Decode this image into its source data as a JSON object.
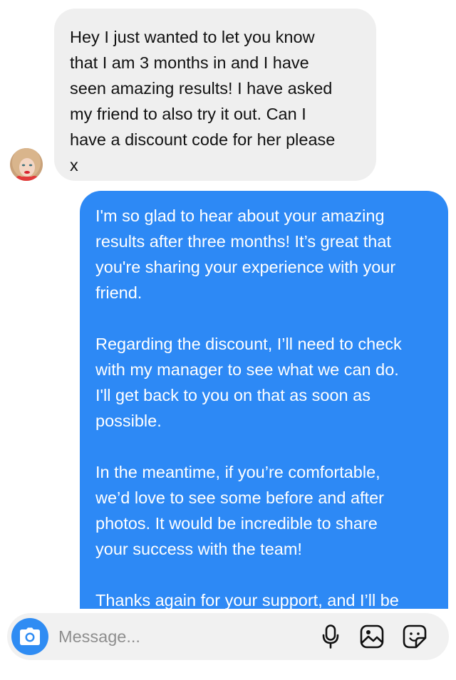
{
  "thread": {
    "incoming": {
      "text": "Hey I just wanted to let you know\nthat I am 3 months in and I have\nseen amazing results! I have asked\nmy friend to also try it out. Can I\nhave a discount code for her please\nx"
    },
    "outgoing": {
      "paragraphs": [
        "I'm so glad to hear about your amazing\nresults after three months! It’s great that\nyou're sharing your experience with your\nfriend.",
        "Regarding the discount, I’ll need to check\nwith my manager to see what we can do.\nI'll get back to you on that as soon as\npossible.",
        "In the meantime, if you’re comfortable,\nwe’d love to see some before and after\nphotos. It would be incredible to share\nyour success with the team!",
        "Thanks again for your support, and I’ll be"
      ]
    }
  },
  "composer": {
    "placeholder": "Message...",
    "icons": [
      "camera-icon",
      "microphone-icon",
      "gallery-icon",
      "sticker-icon"
    ]
  },
  "colors": {
    "incoming_bubble": "#efefef",
    "outgoing_bubble": "#2d89f5",
    "accent": "#2f8cf3"
  }
}
